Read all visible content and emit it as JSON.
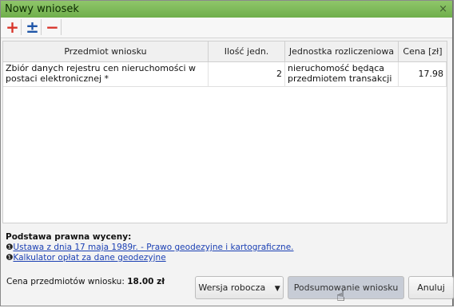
{
  "window": {
    "title": "Nowy wniosek",
    "close_glyph": "×"
  },
  "toolbar": {
    "add_glyph": "+",
    "plusminus_glyph": "±",
    "remove_glyph": "−"
  },
  "table": {
    "columns": [
      "Przedmiot wniosku",
      "Ilość jedn.",
      "Jednostka rozliczeniowa",
      "Cena [zł]"
    ],
    "rows": [
      {
        "subject": "Zbiór danych rejestru cen nieruchomości w postaci elektronicznej *",
        "quantity": "2",
        "unit": "nieruchomość będąca przedmiotem transakcji",
        "price": "17.98"
      }
    ]
  },
  "legal": {
    "label": "Podstawa prawna wyceny:",
    "links": [
      "Ustawa z dnia 17 maja 1989r. - Prawo geodezyjne i kartograficzne.",
      "Kalkulator opłat za dane geodezyjne"
    ],
    "info_glyph": "❶"
  },
  "summary": {
    "label": "Cena przedmiotów wniosku:",
    "value": "18.00 zł"
  },
  "buttons": {
    "draft": "Wersja robocza",
    "draft_caret": "▼",
    "summary": "Podsumowanie wniosku",
    "cancel": "Anuluj"
  },
  "colors": {
    "titlebar": "#7ab956",
    "link": "#1a3fb3",
    "add_remove": "#d8342a",
    "plusminus": "#1e55a8"
  },
  "icons": {
    "add": "plus-icon",
    "plusminus": "plus-minus-icon",
    "remove": "minus-icon",
    "close": "close-icon",
    "info": "info-icon",
    "cursor": "hand-cursor-icon"
  }
}
